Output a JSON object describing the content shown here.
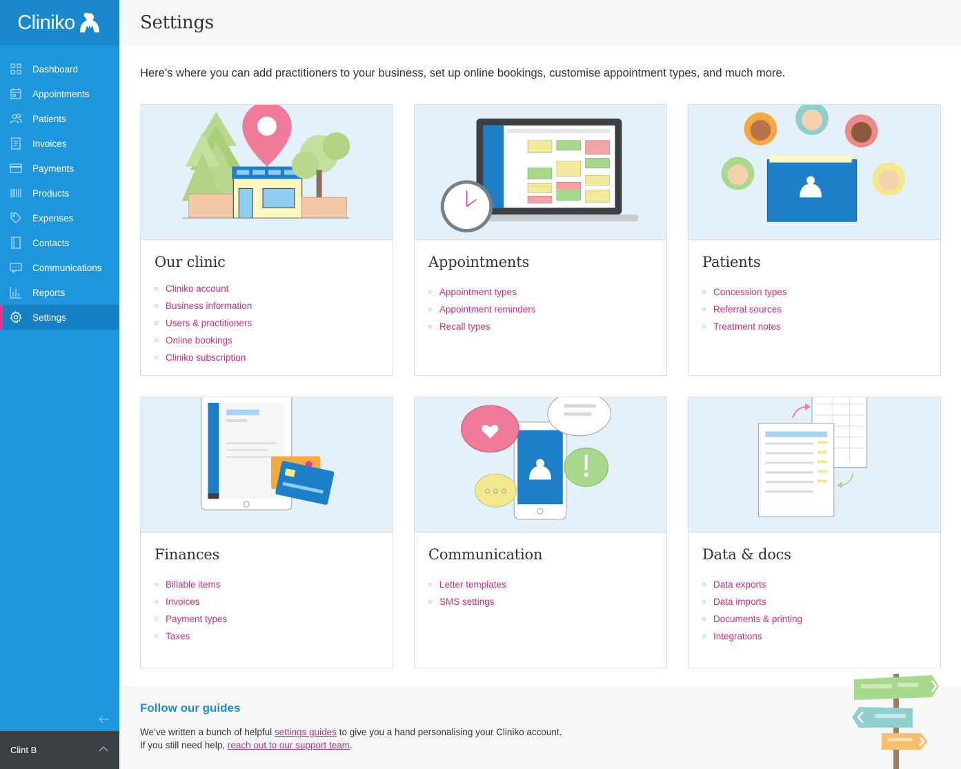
{
  "app": {
    "logo_text": "Cliniko"
  },
  "sidebar": {
    "items": [
      {
        "label": "Dashboard",
        "icon": "dashboard-icon"
      },
      {
        "label": "Appointments",
        "icon": "calendar-icon"
      },
      {
        "label": "Patients",
        "icon": "people-icon"
      },
      {
        "label": "Invoices",
        "icon": "invoice-icon"
      },
      {
        "label": "Payments",
        "icon": "card-icon"
      },
      {
        "label": "Products",
        "icon": "barcode-icon"
      },
      {
        "label": "Expenses",
        "icon": "tag-icon"
      },
      {
        "label": "Contacts",
        "icon": "contacts-icon"
      },
      {
        "label": "Communications",
        "icon": "chat-icon"
      },
      {
        "label": "Reports",
        "icon": "bar-chart-icon"
      },
      {
        "label": "Settings",
        "icon": "gear-icon",
        "active": true
      }
    ],
    "user_name": "Clint B"
  },
  "header": {
    "title": "Settings"
  },
  "intro": "Here’s where you can add practitioners to your business, set up online bookings, customise appointment types, and much more.",
  "cards": [
    {
      "title": "Our clinic",
      "links": [
        "Cliniko account",
        "Business information",
        "Users & practitioners",
        "Online bookings",
        "Cliniko subscription"
      ]
    },
    {
      "title": "Appointments",
      "links": [
        "Appointment types",
        "Appointment reminders",
        "Recall types"
      ]
    },
    {
      "title": "Patients",
      "links": [
        "Concession types",
        "Referral sources",
        "Treatment notes"
      ]
    },
    {
      "title": "Finances",
      "links": [
        "Billable items",
        "Invoices",
        "Payment types",
        "Taxes"
      ]
    },
    {
      "title": "Communication",
      "links": [
        "Letter templates",
        "SMS settings"
      ]
    },
    {
      "title": "Data & docs",
      "links": [
        "Data exports",
        "Data imports",
        "Documents & printing",
        "Integrations"
      ]
    }
  ],
  "guides": {
    "title": "Follow our guides",
    "line1_before": "We’ve written a bunch of helpful ",
    "line1_link": "settings guides",
    "line1_after": " to give you a hand personalising your Cliniko account.",
    "line2_before": "If you still need help, ",
    "line2_link": "reach out to our support team",
    "line2_after": "."
  },
  "colors": {
    "sidebar": "#1e96dd",
    "accent_link": "#d42b80",
    "guides_title": "#1b8fd6"
  }
}
